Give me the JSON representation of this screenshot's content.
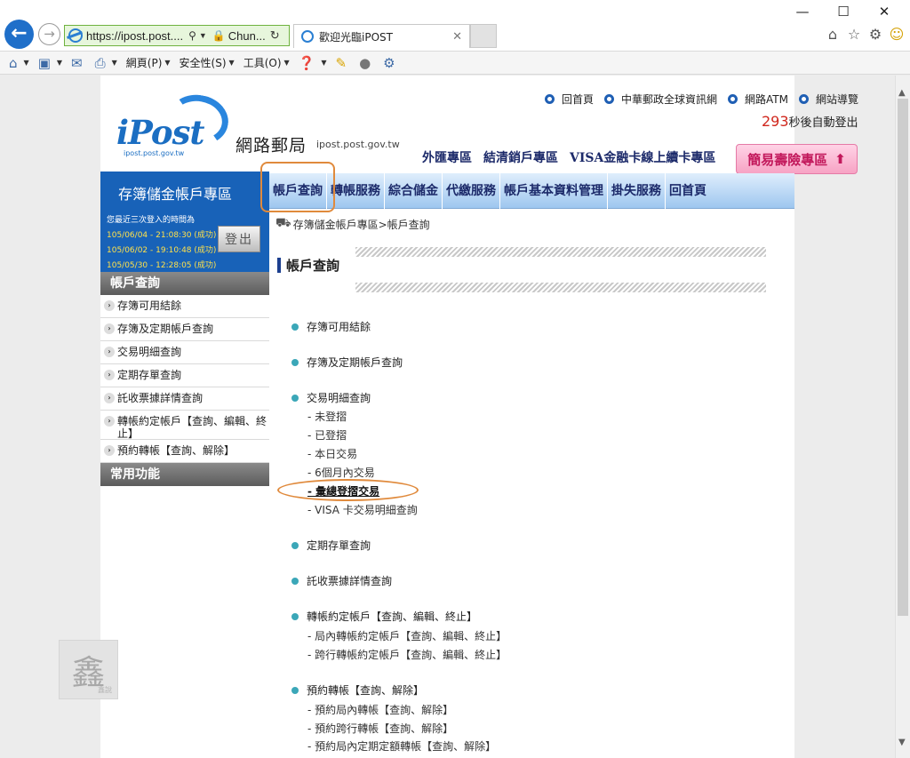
{
  "browser": {
    "url": "https://ipost.post....",
    "cert_label": "Chun...",
    "tab_title": "歡迎光臨iPOST",
    "window_controls": [
      "minimize-icon",
      "maximize-icon",
      "close-icon"
    ],
    "right_icons": [
      "home-icon",
      "favorites-star-icon",
      "settings-gear-icon",
      "smiley-feedback-icon"
    ],
    "command_bar": {
      "page_menu": "網頁(P)",
      "safety_menu": "安全性(S)",
      "tools_menu": "工具(O)"
    }
  },
  "header": {
    "logo_text": "iPost",
    "logo_sub": "ipost.post.gov.tw",
    "site_name": "網路郵局",
    "site_domain": "ipost.post.gov.tw",
    "top_links": [
      "回首頁",
      "中華郵政全球資訊網",
      "網路ATM",
      "網站導覽"
    ],
    "countdown_number": "293",
    "countdown_text": "秒後自動登出",
    "zones": [
      "外匯專區",
      "結清銷戶專區",
      "VISA金融卡線上續卡專區"
    ],
    "insurance_button": "簡易壽險專區",
    "insurance_arrow": "⬆"
  },
  "account_panel": {
    "title": "存簿儲金帳戶專區",
    "login_heading": "您最近三次登入的時間為",
    "login_records": [
      "105/06/04 - 21:08:30 (成功)",
      "105/06/02 - 19:10:48 (成功)",
      "105/05/30 - 12:28:05 (成功)"
    ],
    "logout_label": "登出"
  },
  "main_nav": [
    "帳戶查詢",
    "轉帳服務",
    "綜合儲金",
    "代繳服務",
    "帳戶基本資料管理",
    "掛失服務",
    "回首頁"
  ],
  "sidebar": {
    "section_title": "帳戶查詢",
    "items": [
      "存簿可用結餘",
      "存簿及定期帳戶查詢",
      "交易明細查詢",
      "定期存單查詢",
      "託收票據詳情查詢",
      "轉帳約定帳戶【查詢、編輯、終止】",
      "預約轉帳【查詢、解除】"
    ],
    "common_title": "常用功能"
  },
  "content": {
    "breadcrumb": "存簿儲金帳戶專區>帳戶查詢",
    "title": "帳戶查詢",
    "sections": [
      {
        "label": "存簿可用結餘",
        "subs": []
      },
      {
        "label": "存簿及定期帳戶查詢",
        "subs": []
      },
      {
        "label": "交易明細查詢",
        "subs": [
          "- 未登摺",
          "- 已登摺",
          "- 本日交易",
          "- 6個月內交易",
          "- 彙總登摺交易",
          "- VISA 卡交易明細查詢"
        ]
      },
      {
        "label": "定期存單查詢",
        "subs": []
      },
      {
        "label": "託收票據詳情查詢",
        "subs": []
      },
      {
        "label": "轉帳約定帳戶【查詢、編輯、終止】",
        "subs": [
          "- 局內轉帳約定帳戶【查詢、編輯、終止】",
          "- 跨行轉帳約定帳戶【查詢、編輯、終止】"
        ]
      },
      {
        "label": "預約轉帳【查詢、解除】",
        "subs": [
          "- 預約局內轉帳【查詢、解除】",
          "- 預約跨行轉帳【查詢、解除】",
          "- 預約局內定期定額轉帳【查詢、解除】"
        ]
      }
    ]
  },
  "watermark": {
    "char": "鑫",
    "small": "鑫說"
  },
  "colors": {
    "nav_blue": "#1862b8",
    "highlight_orange": "#e08a3c",
    "bullet_teal": "#3ba7b8",
    "countdown_red": "#d0271d"
  }
}
